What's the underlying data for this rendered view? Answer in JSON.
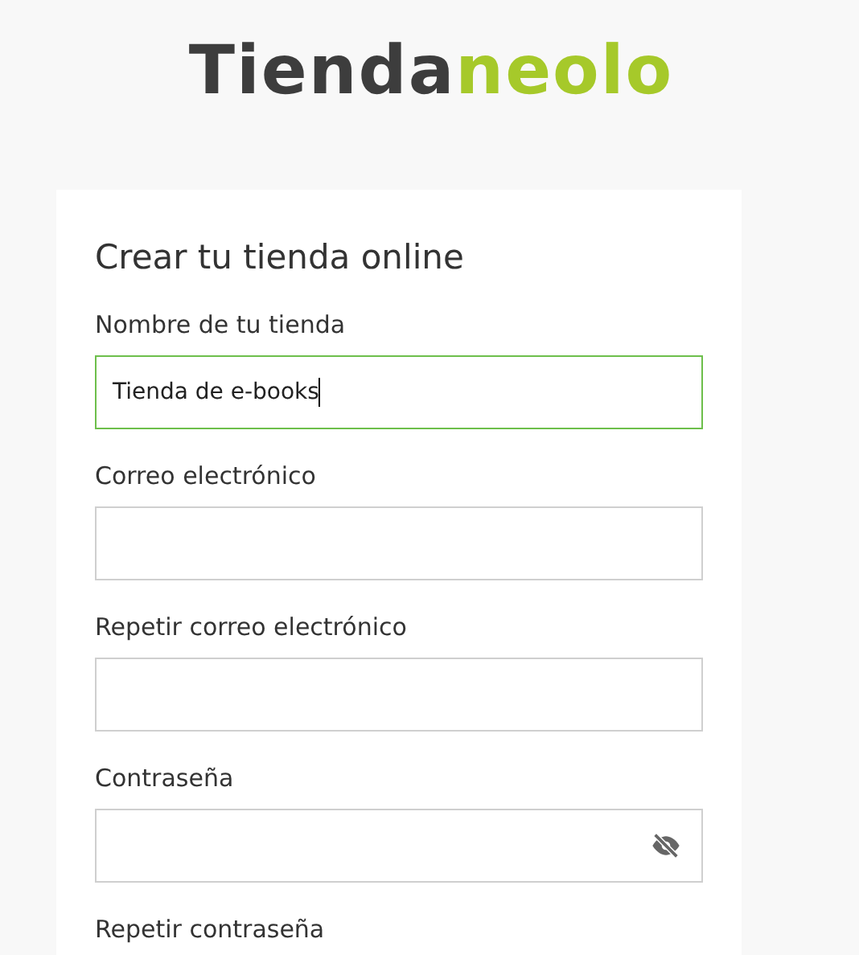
{
  "logo": {
    "part_1": "Tienda",
    "part_2": "neolo"
  },
  "form": {
    "title": "Crear tu tienda online",
    "fields": [
      {
        "kind": "text",
        "label": "Nombre de tu tienda",
        "value": "Tienda de e-books",
        "focused": true
      },
      {
        "kind": "text",
        "label": "Correo electrónico",
        "focused": false
      },
      {
        "kind": "text",
        "label": "Repetir correo electrónico",
        "focused": false
      },
      {
        "kind": "password",
        "label": "Contraseña",
        "focused": false
      },
      {
        "kind": "label",
        "label": "Repetir contraseña"
      }
    ]
  }
}
